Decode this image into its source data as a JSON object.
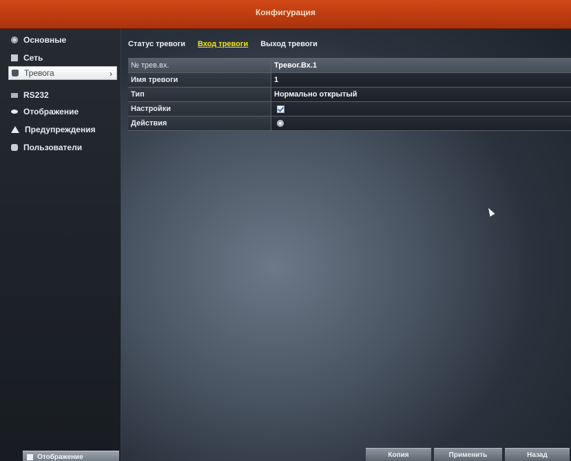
{
  "window": {
    "title": "Конфигурация"
  },
  "sidebar": {
    "items": [
      {
        "label": "Основные",
        "icon": "gear-icon",
        "active": false
      },
      {
        "label": "Сеть",
        "icon": "network-icon",
        "active": false
      },
      {
        "label": "Тревога",
        "icon": "bell-icon",
        "active": true,
        "arrow": "›"
      },
      {
        "label": "RS232",
        "icon": "rs232-icon",
        "active": false
      },
      {
        "label": "Отображение",
        "icon": "eye-icon",
        "active": false
      },
      {
        "label": "Предупреждения",
        "icon": "warning-icon",
        "active": false
      },
      {
        "label": "Пользователи",
        "icon": "users-icon",
        "active": false
      }
    ],
    "bottom_button": "Отображение"
  },
  "tabs": [
    {
      "label": "Статус тревоги",
      "active": false
    },
    {
      "label": "Вход тревоги",
      "active": true
    },
    {
      "label": "Выход тревоги",
      "active": false
    }
  ],
  "table": {
    "rows": [
      {
        "label": "№ трев.вх.",
        "value": "Тревог.Вх.1"
      },
      {
        "label": "Имя тревоги",
        "value": "1"
      },
      {
        "label": "Тип",
        "value": "Нормально открытый"
      },
      {
        "label": "Настройки",
        "value": ""
      },
      {
        "label": "Действия",
        "value": ""
      }
    ]
  },
  "actions": {
    "cancel": "Копия",
    "apply": "Применить",
    "back": "Назад"
  },
  "colors": {
    "title_bar": "#c23d10",
    "active_tab": "#f2e31b",
    "background": "#4a5563"
  }
}
